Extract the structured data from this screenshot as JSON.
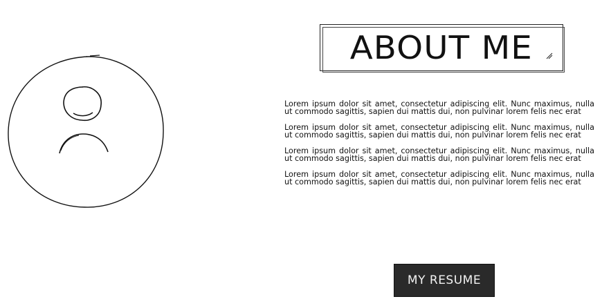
{
  "header": {
    "title": "ABOUT ME"
  },
  "avatar": {
    "icon": "user-silhouette-icon"
  },
  "content": {
    "paragraphs": [
      "Lorem ipsum dolor sit amet, consectetur adipiscing elit. Nunc maximus, nulla ut commodo sagittis, sapien dui mattis dui, non pulvinar lorem felis nec erat",
      "Lorem ipsum dolor sit amet, consectetur adipiscing elit. Nunc maximus, nulla ut commodo sagittis, sapien dui mattis dui, non pulvinar lorem felis nec erat",
      "Lorem ipsum dolor sit amet, consectetur adipiscing elit. Nunc maximus, nulla ut commodo sagittis, sapien dui mattis dui, non pulvinar lorem felis nec erat",
      "Lorem ipsum dolor sit amet, consectetur adipiscing elit. Nunc maximus, nulla ut commodo sagittis, sapien dui mattis dui, non pulvinar lorem felis nec erat"
    ]
  },
  "actions": {
    "resume_label": "MY RESUME"
  },
  "colors": {
    "background": "#ffffff",
    "ink": "#111111",
    "button_bg": "#2a2a2a",
    "button_text": "#f2f2f2"
  }
}
